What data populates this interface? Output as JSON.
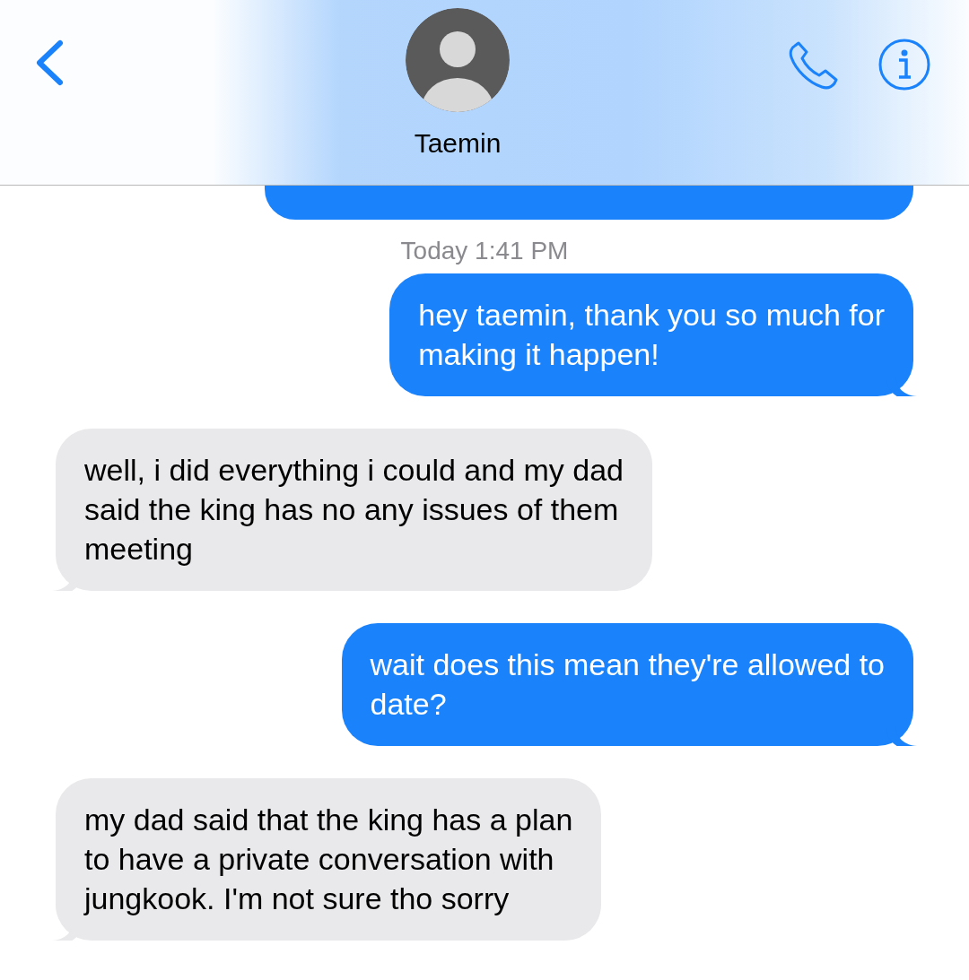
{
  "header": {
    "title": "Taemin"
  },
  "messages": [
    {
      "kind": "timestamp",
      "lines": [
        "Today 1:41 PM"
      ]
    },
    {
      "kind": "sent",
      "lines": [
        "hey taemin, thank you so much for",
        "making it happen!"
      ]
    },
    {
      "kind": "received",
      "lines": [
        "well, i did everything i could and my dad",
        "said the king has no any issues of them",
        "meeting"
      ]
    },
    {
      "kind": "sent",
      "lines": [
        "wait does this mean they're allowed to",
        "date?"
      ]
    },
    {
      "kind": "received",
      "lines": [
        "my dad said that the king has a plan",
        "to have a private conversation with",
        "jungkook. I'm not sure tho sorry"
      ]
    }
  ]
}
